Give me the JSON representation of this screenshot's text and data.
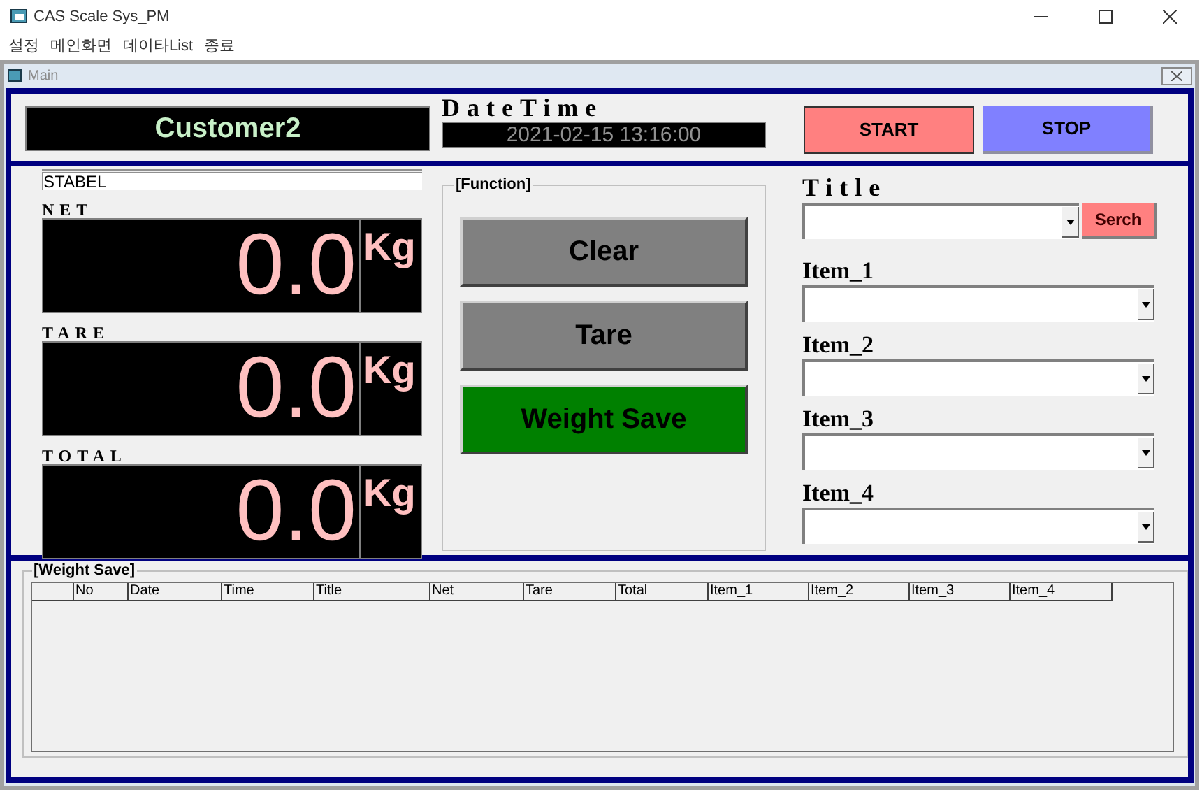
{
  "window": {
    "title": "CAS Scale Sys_PM"
  },
  "menu": [
    "설정",
    "메인화면",
    "데이타List",
    "종료"
  ],
  "child_window": {
    "title": "Main"
  },
  "customer": "Customer2",
  "datetime": {
    "label": "DateTime",
    "value": "2021-02-15 13:16:00"
  },
  "top_buttons": [
    {
      "label": "START",
      "color": "#ff8080"
    },
    {
      "label": "STOP",
      "color": "#8080ff"
    }
  ],
  "status": {
    "text": "STABEL"
  },
  "displays": [
    {
      "label": "NET",
      "value": "0.0",
      "unit": "Kg"
    },
    {
      "label": "TARE",
      "value": "0.0",
      "unit": "Kg"
    },
    {
      "label": "TOTAL",
      "value": "0.0",
      "unit": "Kg"
    }
  ],
  "function_group": {
    "title": "[Function]",
    "buttons": [
      {
        "label": "Clear",
        "color": "#808080"
      },
      {
        "label": "Tare",
        "color": "#808080"
      },
      {
        "label": "Weight Save",
        "color": "#008000"
      }
    ]
  },
  "title_search": {
    "label": "Title",
    "button": "Serch"
  },
  "items": [
    {
      "label": "Item_1"
    },
    {
      "label": "Item_2"
    },
    {
      "label": "Item_3"
    },
    {
      "label": "Item_4"
    }
  ],
  "weight_save": {
    "title": "[Weight Save]",
    "columns": [
      "No",
      "Date",
      "Time",
      "Title",
      "Net",
      "Tare",
      "Total",
      "Item_1",
      "Item_2",
      "Item_3",
      "Item_4"
    ]
  }
}
